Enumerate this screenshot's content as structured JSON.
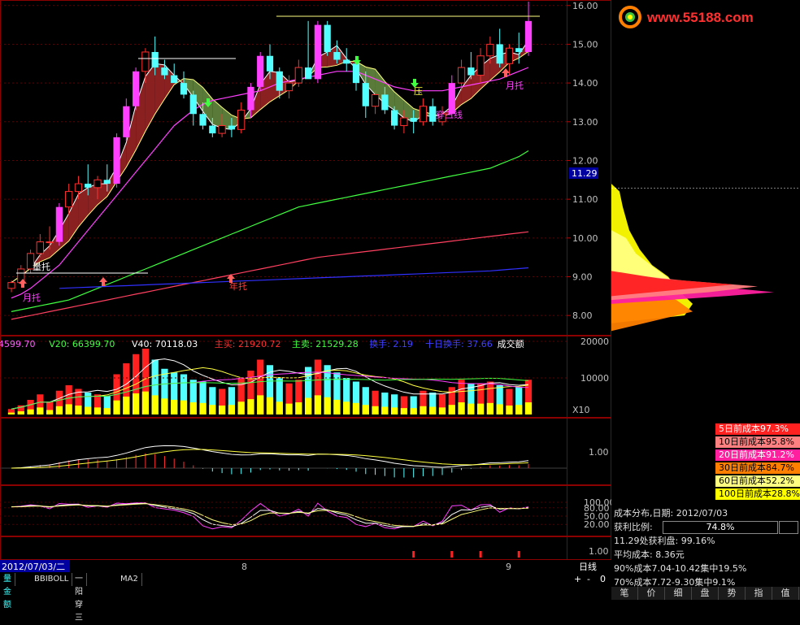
{
  "logo": {
    "text": "www.55188.com"
  },
  "price_axis": {
    "ticks": [
      "16.00",
      "15.00",
      "14.00",
      "13.00",
      "12.00",
      "11.00",
      "10.00",
      "9.00",
      "8.00"
    ],
    "current": "11.29"
  },
  "vol_axis": {
    "ticks": [
      "20000",
      "10000"
    ],
    "multiplier": "X10"
  },
  "macd_axis": {
    "ticks": [
      "1.00"
    ]
  },
  "kdj_axis": {
    "ticks": [
      "100.00",
      "80.00",
      "50.00",
      "20.00"
    ]
  },
  "bottom_axis": {
    "ticks": [
      "1.00"
    ]
  },
  "date_label": "2012/07/03/二",
  "month_marks": [
    "8",
    "9"
  ],
  "period_label": "日线",
  "zoom_controls": [
    "+",
    "-",
    "0"
  ],
  "annotations": {
    "liang_tuo": "量托",
    "yue_tuo_1": "月托",
    "nian_tuo": "年托",
    "chuan_san_xian": "穿三线",
    "ya": "压",
    "yue_tuo_2": "月托"
  },
  "volume_header": [
    {
      "text": "4599.70",
      "color": "#ff60ff"
    },
    {
      "text": "V20: 66399.70",
      "color": "#40ff40"
    },
    {
      "text": "V40: 70118.03",
      "color": "#ffffff"
    },
    {
      "text": "主买: 21920.72",
      "color": "#ff3030"
    },
    {
      "text": "主卖: 21529.28",
      "color": "#40ff40"
    },
    {
      "text": "换手: 2.19",
      "color": "#4040ff"
    },
    {
      "text": "十日换手: 37.66",
      "color": "#4040ff"
    },
    {
      "text": "成交额",
      "color": "#ffffff"
    }
  ],
  "cost_legend": [
    {
      "label": "5日前成本97.3%",
      "bg": "#ff2020",
      "fg": "#ffffff"
    },
    {
      "label": "10日前成本95.8%",
      "bg": "#ff8080",
      "fg": "#000000"
    },
    {
      "label": "20日前成本91.2%",
      "bg": "#ff20a0",
      "fg": "#ffffff"
    },
    {
      "label": "30日前成本84.7%",
      "bg": "#ff8000",
      "fg": "#000000"
    },
    {
      "label": "60日前成本52.2%",
      "bg": "#ffff80",
      "fg": "#000000"
    },
    {
      "label": "100日前成本28.8%",
      "bg": "#ffff00",
      "fg": "#000000"
    }
  ],
  "cost_info": {
    "title": "成本分布,日期: 2012/07/03",
    "profit_label": "获利比例:",
    "profit_value": "74.8%",
    "profit_ratio": 0.748,
    "line1": "11.29处获利盘: 99.16%",
    "line2": "平均成本: 8.36元",
    "line3": "90%成本7.04-10.42集中19.5%",
    "line4": "70%成本7.72-9.30集中9.1%"
  },
  "bottom_tabs": [
    "量金额",
    "BBIBOLL",
    "一阳穿三",
    "MA2"
  ],
  "right_tabs": [
    "笔",
    "价",
    "细",
    "盘",
    "势",
    "指",
    "值"
  ],
  "colors": {
    "up": "#ff3030",
    "up_hollow": "#ff3030",
    "down": "#54ffff",
    "pink": "#ff40ff",
    "yellow": "#ffff00",
    "ma_green": "#40ff40",
    "ma_red": "#ff4060",
    "ma_blue": "#3030ff",
    "ma_purple": "#ff40ff"
  },
  "chart_data": {
    "type": "candlestick",
    "price_ylim": [
      7.5,
      16.1
    ],
    "candles": [
      [
        8.7,
        8.9,
        8.6,
        8.85
      ],
      [
        8.85,
        9.3,
        8.8,
        9.2
      ],
      [
        9.2,
        9.7,
        9.1,
        9.6
      ],
      [
        9.6,
        10.1,
        9.5,
        9.9
      ],
      [
        9.9,
        10.3,
        9.7,
        9.9
      ],
      [
        9.9,
        10.9,
        9.8,
        10.8
      ],
      [
        10.8,
        11.4,
        10.6,
        11.2
      ],
      [
        11.2,
        11.6,
        11.0,
        11.4
      ],
      [
        11.4,
        11.9,
        11.1,
        11.3
      ],
      [
        11.3,
        11.6,
        11.0,
        11.5
      ],
      [
        11.5,
        11.9,
        11.2,
        11.4
      ],
      [
        11.4,
        12.7,
        11.3,
        12.6
      ],
      [
        12.6,
        13.6,
        12.5,
        13.4
      ],
      [
        13.4,
        14.4,
        13.3,
        14.3
      ],
      [
        14.3,
        14.9,
        14.0,
        14.8
      ],
      [
        14.8,
        15.2,
        14.2,
        14.4
      ],
      [
        14.4,
        14.6,
        14.1,
        14.2
      ],
      [
        14.2,
        14.5,
        14.0,
        14.0
      ],
      [
        14.0,
        14.3,
        13.6,
        13.7
      ],
      [
        13.7,
        13.8,
        12.9,
        13.2
      ],
      [
        13.2,
        13.5,
        12.8,
        12.9
      ],
      [
        12.9,
        13.1,
        12.6,
        12.7
      ],
      [
        12.7,
        13.2,
        12.6,
        12.9
      ],
      [
        12.9,
        13.1,
        12.6,
        12.8
      ],
      [
        12.8,
        13.5,
        12.7,
        13.3
      ],
      [
        13.3,
        14.0,
        13.1,
        13.9
      ],
      [
        13.9,
        14.8,
        13.8,
        14.7
      ],
      [
        14.7,
        15.0,
        14.1,
        14.3
      ],
      [
        14.3,
        14.4,
        13.6,
        13.8
      ],
      [
        13.8,
        14.2,
        13.6,
        14.0
      ],
      [
        14.0,
        14.6,
        13.9,
        14.4
      ],
      [
        14.4,
        15.6,
        14.2,
        14.1
      ],
      [
        14.1,
        15.6,
        14.0,
        15.5
      ],
      [
        15.5,
        15.6,
        14.7,
        14.8
      ],
      [
        14.8,
        15.1,
        14.5,
        14.6
      ],
      [
        14.6,
        14.9,
        14.3,
        14.5
      ],
      [
        14.5,
        14.7,
        13.8,
        14.0
      ],
      [
        14.0,
        14.3,
        13.1,
        13.4
      ],
      [
        13.4,
        13.8,
        13.2,
        13.7
      ],
      [
        13.7,
        13.9,
        13.2,
        13.3
      ],
      [
        13.3,
        13.4,
        12.8,
        12.9
      ],
      [
        12.9,
        13.3,
        12.7,
        13.1
      ],
      [
        13.1,
        13.3,
        12.7,
        13.0
      ],
      [
        13.0,
        13.6,
        12.9,
        13.4
      ],
      [
        13.4,
        13.6,
        12.9,
        13.0
      ],
      [
        13.0,
        13.4,
        12.9,
        13.2
      ],
      [
        13.2,
        14.2,
        13.1,
        14.0
      ],
      [
        14.0,
        14.6,
        13.8,
        14.4
      ],
      [
        14.4,
        14.8,
        14.1,
        14.2
      ],
      [
        14.2,
        14.9,
        14.0,
        14.7
      ],
      [
        14.7,
        15.2,
        14.5,
        15.0
      ],
      [
        15.0,
        15.4,
        14.4,
        14.5
      ],
      [
        14.5,
        15.0,
        14.2,
        14.9
      ],
      [
        14.9,
        15.3,
        14.5,
        14.8
      ],
      [
        14.8,
        16.1,
        14.7,
        15.6
      ]
    ],
    "volumes": [
      300,
      500,
      800,
      1100,
      700,
      1300,
      1600,
      1400,
      1200,
      1100,
      1000,
      2200,
      2800,
      3300,
      3600,
      3000,
      2500,
      2300,
      2200,
      1900,
      1800,
      1500,
      1400,
      1500,
      2000,
      2400,
      3000,
      2700,
      2000,
      1700,
      1900,
      2600,
      3000,
      2700,
      2300,
      2000,
      1800,
      1500,
      1300,
      1200,
      1100,
      1000,
      1000,
      1300,
      1200,
      1100,
      1500,
      1900,
      1700,
      1700,
      1800,
      1600,
      1400,
      1500,
      1900
    ],
    "ma_lines": [
      {
        "name": "MA20",
        "color": "#ff40ff",
        "values": [
          8.45,
          8.55,
          8.7,
          8.9,
          9.1,
          9.3,
          9.6,
          9.9,
          10.2,
          10.5,
          10.8,
          11.1,
          11.4,
          11.7,
          12.0,
          12.3,
          12.6,
          12.9,
          13.1,
          13.3,
          13.45,
          13.55,
          13.6,
          13.65,
          13.7,
          13.75,
          13.8,
          13.9,
          14.0,
          14.05,
          14.1,
          14.15,
          14.2,
          14.25,
          14.3,
          14.3,
          14.3,
          14.2,
          14.1,
          14.0,
          13.9,
          13.85,
          13.8,
          13.8,
          13.8,
          13.8,
          13.85,
          13.9,
          13.95,
          14.0,
          14.05,
          14.1,
          14.2,
          14.3,
          14.4
        ]
      },
      {
        "name": "MA60",
        "color": "#40ff40",
        "values": [
          8.1,
          8.15,
          8.2,
          8.25,
          8.3,
          8.35,
          8.4,
          8.5,
          8.6,
          8.7,
          8.8,
          8.9,
          9.0,
          9.1,
          9.2,
          9.3,
          9.4,
          9.5,
          9.6,
          9.7,
          9.8,
          9.9,
          10.0,
          10.1,
          10.2,
          10.3,
          10.4,
          10.5,
          10.6,
          10.7,
          10.8,
          10.85,
          10.9,
          10.95,
          11.0,
          11.05,
          11.1,
          11.15,
          11.2,
          11.25,
          11.3,
          11.35,
          11.4,
          11.45,
          11.5,
          11.55,
          11.6,
          11.65,
          11.7,
          11.75,
          11.8,
          11.9,
          12.0,
          12.1,
          12.25
        ]
      },
      {
        "name": "MA120",
        "color": "#ff4060",
        "values": [
          7.9,
          7.95,
          8.0,
          8.05,
          8.1,
          8.15,
          8.2,
          8.25,
          8.3,
          8.35,
          8.4,
          8.45,
          8.5,
          8.55,
          8.6,
          8.65,
          8.7,
          8.75,
          8.8,
          8.85,
          8.9,
          8.95,
          9.0,
          9.05,
          9.1,
          9.15,
          9.2,
          9.25,
          9.3,
          9.35,
          9.4,
          9.45,
          9.5,
          9.53,
          9.56,
          9.59,
          9.62,
          9.65,
          9.68,
          9.71,
          9.74,
          9.77,
          9.8,
          9.83,
          9.86,
          9.89,
          9.92,
          9.95,
          9.98,
          10.01,
          10.04,
          10.07,
          10.1,
          10.13,
          10.16
        ]
      },
      {
        "name": "MA250",
        "color": "#3030ff",
        "values": [
          null,
          null,
          null,
          null,
          null,
          8.7,
          8.71,
          8.72,
          8.73,
          8.74,
          8.75,
          8.76,
          8.77,
          8.78,
          8.79,
          8.8,
          8.81,
          8.82,
          8.83,
          8.84,
          8.85,
          8.86,
          8.87,
          8.88,
          8.89,
          8.9,
          8.91,
          8.92,
          8.93,
          8.94,
          8.95,
          8.96,
          8.97,
          8.98,
          8.99,
          9.0,
          9.01,
          9.02,
          9.03,
          9.04,
          9.05,
          9.06,
          9.07,
          9.08,
          9.09,
          9.1,
          9.11,
          9.12,
          9.13,
          9.14,
          9.15,
          9.17,
          9.19,
          9.21,
          9.23
        ]
      }
    ]
  }
}
